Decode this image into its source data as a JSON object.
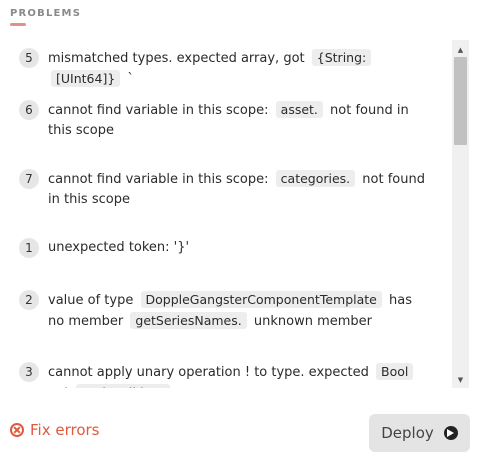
{
  "panel": {
    "title": "PROBLEMS"
  },
  "problems": [
    {
      "number": "5",
      "segments": [
        {
          "type": "text",
          "value": "mismatched types. expected array, got"
        },
        {
          "type": "code",
          "value": "{String:"
        },
        {
          "type": "code",
          "value": "[UInt64]}"
        },
        {
          "type": "text",
          "value": "`"
        }
      ]
    },
    {
      "number": "6",
      "segments": [
        {
          "type": "text",
          "value": "cannot find variable in this scope:"
        },
        {
          "type": "code",
          "value": "asset."
        },
        {
          "type": "text",
          "value": "not found in this scope"
        }
      ]
    },
    {
      "number": "7",
      "segments": [
        {
          "type": "text",
          "value": "cannot find variable in this scope:"
        },
        {
          "type": "code",
          "value": "categories."
        },
        {
          "type": "text",
          "value": "not found in this scope"
        }
      ]
    },
    {
      "number": "1",
      "segments": [
        {
          "type": "text",
          "value": "unexpected token: '}'"
        }
      ]
    },
    {
      "number": "2",
      "segments": [
        {
          "type": "text",
          "value": "value of type"
        },
        {
          "type": "code",
          "value": "DoppleGangsterComponentTemplate"
        },
        {
          "type": "text",
          "value": "has no member"
        },
        {
          "type": "code",
          "value": "getSeriesNames."
        },
        {
          "type": "text",
          "value": "unknown member"
        }
      ]
    },
    {
      "number": "3",
      "segments": [
        {
          "type": "text",
          "value": "cannot apply unary operation ! to type. expected"
        },
        {
          "type": "code",
          "value": "Bool"
        },
        {
          "type": "text",
          "value": "got"
        },
        {
          "type": "code",
          "value": "<<invalid>>"
        }
      ]
    }
  ],
  "actions": {
    "fix_errors_label": "Fix errors",
    "deploy_label": "Deploy"
  },
  "icons": {
    "fix": "close-circle-icon",
    "deploy": "arrow-right-circle-icon",
    "scroll_up": "triangle-up",
    "scroll_down": "triangle-down"
  },
  "colors": {
    "error": "#e05a3e",
    "accent_underline": "#e4908a"
  }
}
